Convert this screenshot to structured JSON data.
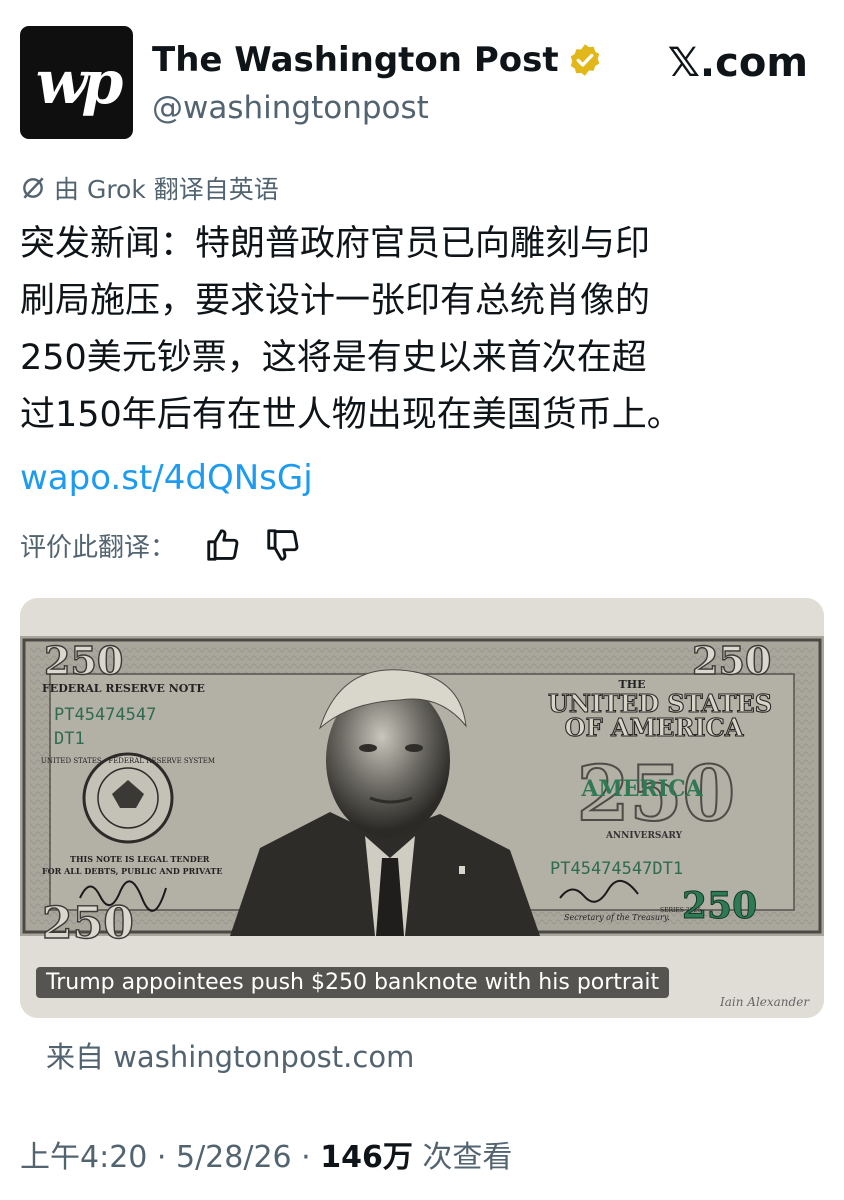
{
  "header": {
    "avatar_letters": "wp",
    "name": "The Washington Post",
    "handle": "@washingtonpost",
    "site": "𝕏.com",
    "verified_icon": "gold-verified-badge-icon"
  },
  "tweet": {
    "translated_by": "由 Grok 翻译自英语",
    "text_lines": [
      "突发新闻：特朗普政府官员已向雕刻与印",
      "刷局施压，要求设计一张印有总统肖像的",
      "250美元钞票，这将是有史以来首次在超",
      "过150年后有在世人物出现在美国货币上。"
    ],
    "link": "wapo.st/4dQNsGj",
    "rate_label": "评价此翻译："
  },
  "media": {
    "caption": "Trump appointees push $250 banknote with his portrait",
    "banknote": {
      "denomination": "250",
      "header_left": "FEDERAL RESERVE NOTE",
      "serial": "PT45474547",
      "serial_suffix": "DT1",
      "full_serial": "PT45474547DT1",
      "the": "THE",
      "united_states": "UNITED STATES",
      "of_america": "OF AMERICA",
      "america": "AMERICA",
      "anniversary": "ANNIVERSARY",
      "seal_text": "UNITED STATES · FEDERAL RESERVE SYSTEM",
      "legal_tender": "THIS NOTE IS LEGAL TENDER",
      "legal_tender_2": "FOR ALL DEBTS, PUBLIC AND PRIVATE",
      "secretary": "Secretary of the Treasury.",
      "series": "SERIES 2026",
      "photo_credit": "Iain Alexander"
    }
  },
  "source": "来自 washingtonpost.com",
  "meta": {
    "time": "上午4:20",
    "date": "5/28/26",
    "views": "146万",
    "views_label": "次查看",
    "sep": " · "
  }
}
